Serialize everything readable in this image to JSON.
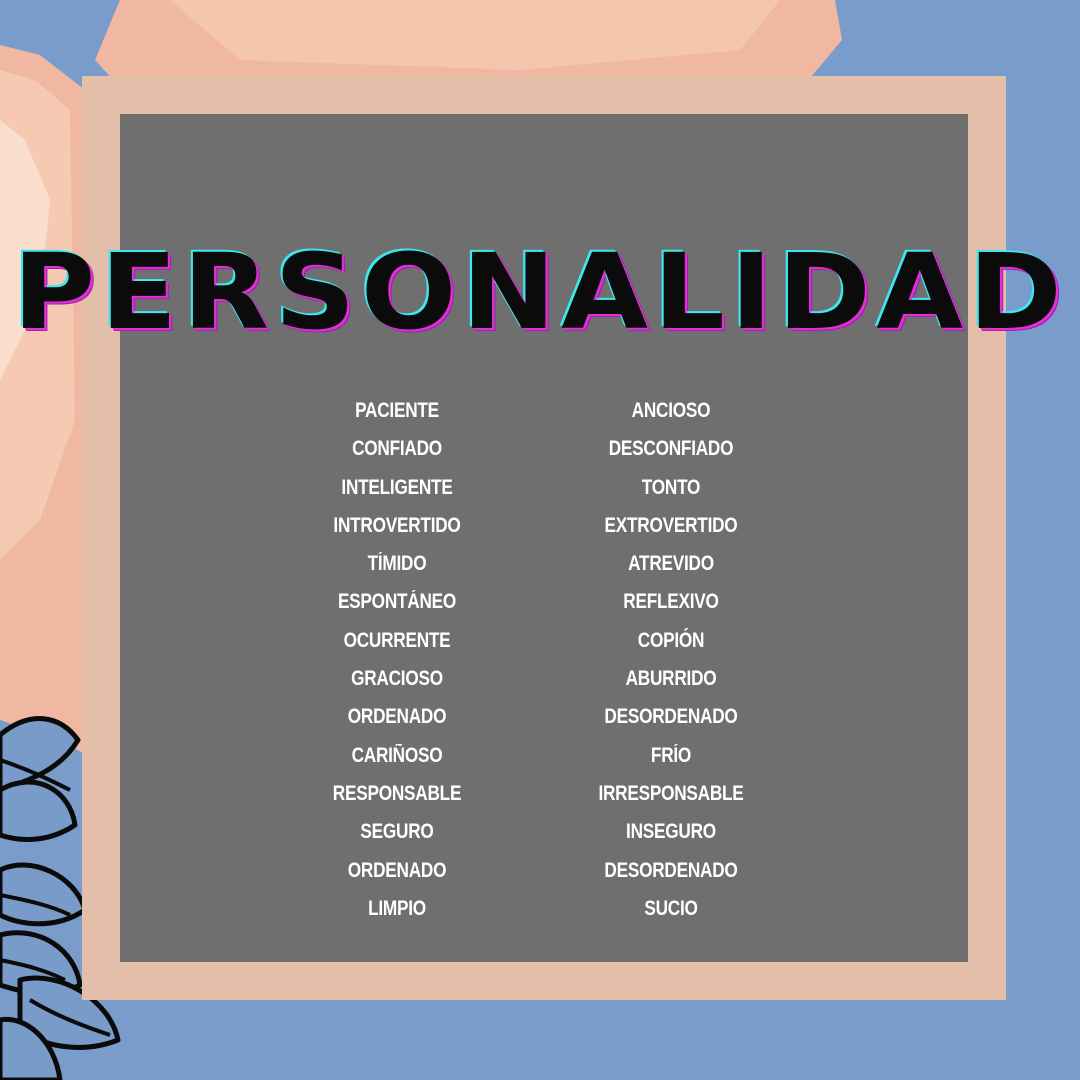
{
  "title": "PERSONALIDAD",
  "colors": {
    "background_blue": "#799ccb",
    "peach_paint": "#f0b8a0",
    "frame": "#e3bfa9",
    "board": "#6f6f6f",
    "title_text": "#0b0b0b",
    "title_glow_magenta": "#e22fd6",
    "title_glow_cyan": "#3ce8f0",
    "word_text": "#ffffff",
    "flower_outline": "#0b0b0b"
  },
  "decorations": [
    "watercolor-brush-stroke",
    "flower-line-art"
  ],
  "left_words": [
    {
      "text": "PACIENTE"
    },
    {
      "text": "CONFIADO"
    },
    {
      "text": "INTELIGENTE"
    },
    {
      "text": "INTROVERTIDO"
    },
    {
      "text": "TÍMIDO"
    },
    {
      "text": "ESPONTÁNEO"
    },
    {
      "text": "OCURRENTE"
    },
    {
      "text": "GRACIOSO"
    },
    {
      "text": "ORDENADO"
    },
    {
      "text": "CARIÑOSO"
    },
    {
      "text": "RESPONSABLE"
    },
    {
      "text": "SEGURO"
    },
    {
      "text": "ORDENADO"
    },
    {
      "text": "LIMPIO"
    }
  ],
  "right_words": [
    {
      "text": "ANCIOSO"
    },
    {
      "text": "DESCONFIADO"
    },
    {
      "text": "TONTO"
    },
    {
      "text": "EXTROVERTIDO"
    },
    {
      "text": "ATREVIDO"
    },
    {
      "text": "REFLEXIVO"
    },
    {
      "text": "COPIÓN"
    },
    {
      "text": "ABURRIDO"
    },
    {
      "text": "DESORDENADO"
    },
    {
      "text": "FRÍO"
    },
    {
      "text": "IRRESPONSABLE"
    },
    {
      "text": "INSEGURO"
    },
    {
      "text": "DESORDENADO"
    },
    {
      "text": "SUCIO"
    }
  ]
}
